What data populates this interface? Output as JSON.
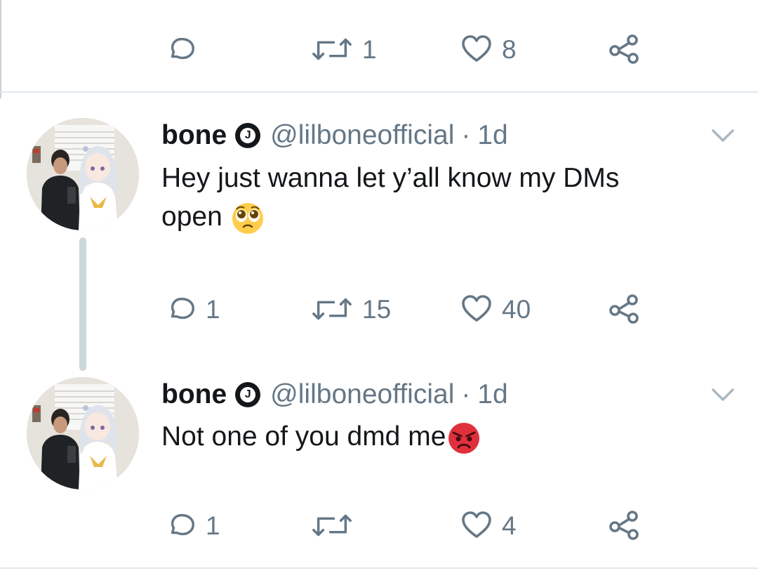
{
  "top_action_bar": {
    "reply_count": "",
    "retweet_count": "1",
    "like_count": "8"
  },
  "tweets": [
    {
      "author_name": "bone",
      "verified_badge_letter": "J",
      "handle": "@lilboneofficial",
      "separator": "·",
      "time": "1d",
      "text_line1": "Hey just wanna let y’all know my DMs",
      "text_line2": "open",
      "emoji": "pleading-face-emoji",
      "reply_count": "1",
      "retweet_count": "15",
      "like_count": "40"
    },
    {
      "author_name": "bone",
      "verified_badge_letter": "J",
      "handle": "@lilboneofficial",
      "separator": "·",
      "time": "1d",
      "text_line1": "Not one of you dmd me",
      "emoji": "angry-face-emoji",
      "reply_count": "1",
      "retweet_count": "",
      "like_count": "4"
    }
  ],
  "icons": {
    "reply": "reply-icon",
    "retweet": "retweet-icon",
    "like": "heart-icon",
    "share": "share-icon",
    "caret": "chevron-down-icon"
  },
  "colors": {
    "text": "#14171a",
    "secondary": "#657786",
    "divider": "#e1e8ed",
    "thread_line": "#ccd6dd",
    "angry_red": "#e0303e",
    "pleading_yellow": "#ffcc4d"
  }
}
